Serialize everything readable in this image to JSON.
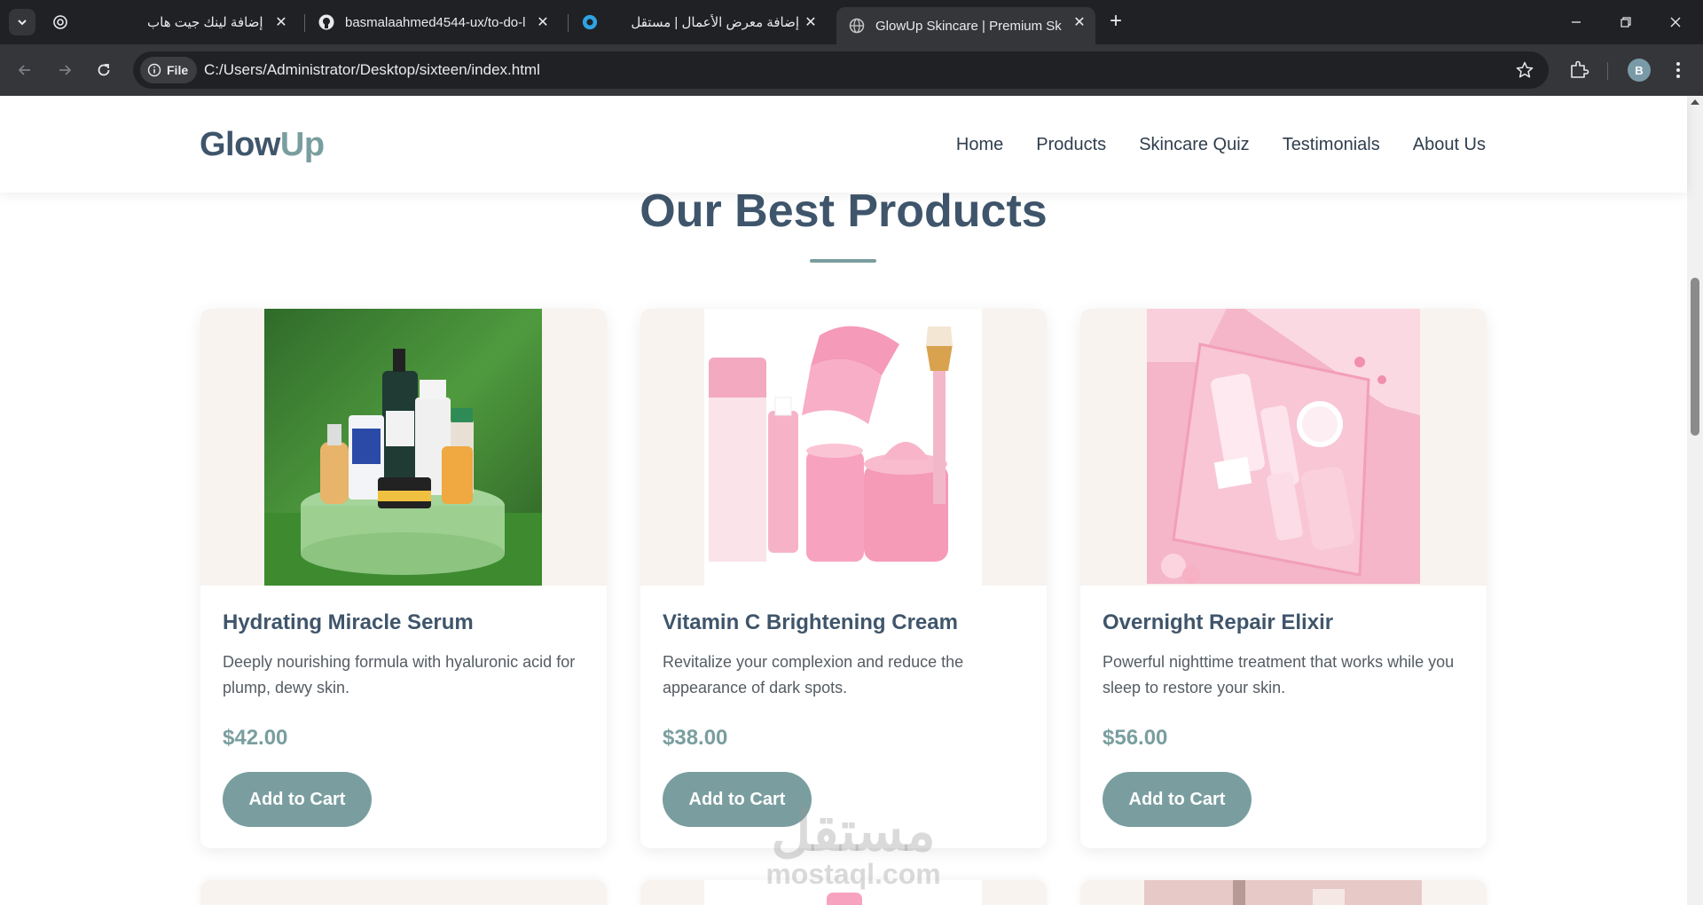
{
  "browser": {
    "tabs": [
      {
        "title": "إضافة لينك جيت هاب",
        "icon": "chatgpt-icon"
      },
      {
        "title": "basmalaahmed4544-ux/to-do-l",
        "icon": "github-icon"
      },
      {
        "title": "إضافة معرض الأعمال | مستقل",
        "icon": "mostaql-icon"
      },
      {
        "title": "GlowUp Skincare | Premium Skin",
        "icon": "globe-icon"
      }
    ],
    "site_info_label": "File",
    "url": "C:/Users/Administrator/Desktop/sixteen/index.html",
    "profile_initial": "B"
  },
  "site": {
    "logo_part1": "Glow",
    "logo_part2": "Up",
    "nav": [
      "Home",
      "Products",
      "Skincare Quiz",
      "Testimonials",
      "About Us"
    ]
  },
  "section": {
    "title": "Our Best Products"
  },
  "products": [
    {
      "name": "Hydrating Miracle Serum",
      "description": "Deeply nourishing formula with hyaluronic acid for plump, dewy skin.",
      "price": "$42.00",
      "button": "Add to Cart"
    },
    {
      "name": "Vitamin C Brightening Cream",
      "description": "Revitalize your complexion and reduce the appearance of dark spots.",
      "price": "$38.00",
      "button": "Add to Cart"
    },
    {
      "name": "Overnight Repair Elixir",
      "description": "Powerful nighttime treatment that works while you sleep to restore your skin.",
      "price": "$56.00",
      "button": "Add to Cart"
    }
  ],
  "watermark": {
    "line1": "مستقل",
    "line2": "mostaql.com"
  },
  "colors": {
    "primary": "#3f556b",
    "accent": "#7a9e9f",
    "card_media_bg": "#f8f3ef"
  }
}
